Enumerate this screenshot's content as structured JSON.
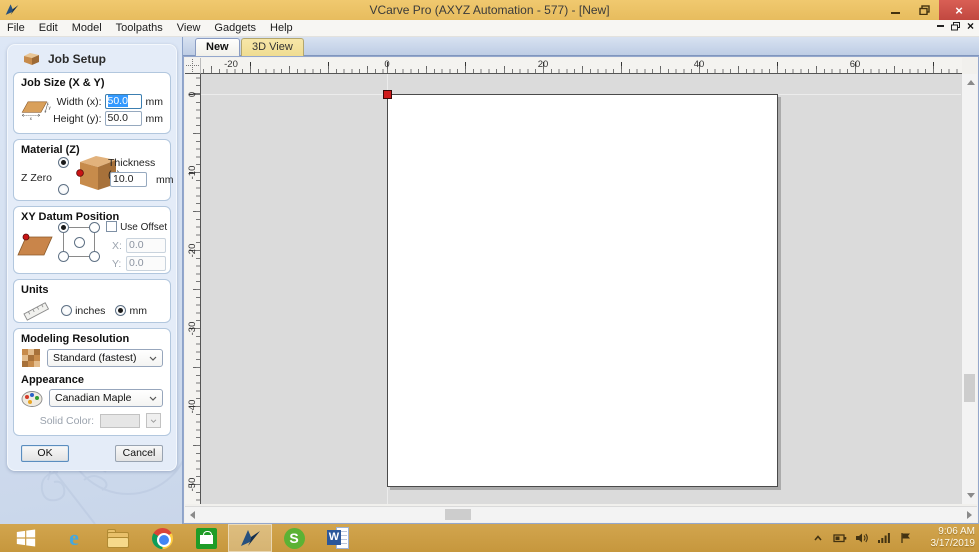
{
  "window": {
    "title": "VCarve Pro (AXYZ Automation - 577) - [New]"
  },
  "menu": {
    "items": [
      "File",
      "Edit",
      "Model",
      "Toolpaths",
      "View",
      "Gadgets",
      "Help"
    ]
  },
  "tabs": [
    {
      "label": "New",
      "active": true
    },
    {
      "label": "3D View",
      "active": false
    }
  ],
  "panel": {
    "title": "Job Setup",
    "job_size": {
      "title": "Job Size (X & Y)",
      "width_label": "Width (x):",
      "width_value": "50.0",
      "height_label": "Height (y):",
      "height_value": "50.0",
      "unit": "mm",
      "axis_x": "x",
      "axis_y": "y"
    },
    "material": {
      "title": "Material (Z)",
      "z_zero_label": "Z Zero",
      "thickness_label": "Thickness (z)",
      "thickness_value": "10.0",
      "unit": "mm"
    },
    "datum": {
      "title": "XY Datum Position",
      "use_offset_label": "Use Offset",
      "x_label": "X:",
      "x_value": "0.0",
      "y_label": "Y:",
      "y_value": "0.0"
    },
    "units": {
      "title": "Units",
      "inches_label": "inches",
      "mm_label": "mm",
      "selected": "mm"
    },
    "modeling": {
      "title": "Modeling Resolution",
      "value": "Standard (fastest)"
    },
    "appearance": {
      "title": "Appearance",
      "value": "Canadian Maple",
      "solid_color_label": "Solid Color:"
    },
    "ok_label": "OK",
    "cancel_label": "Cancel"
  },
  "rulers": {
    "h": [
      "-20",
      "0",
      "20",
      "40",
      "60"
    ],
    "v": [
      "0",
      "-10",
      "-20",
      "-30",
      "-40",
      "-50"
    ]
  },
  "taskbar": {
    "icons": [
      "start",
      "internet-explorer",
      "file-explorer",
      "chrome",
      "windows-store",
      "vcarve",
      "skype",
      "word"
    ],
    "time": "9:06 AM",
    "date": "3/17/2019"
  },
  "colors": {
    "titlebar_gold": "#E9BE63",
    "taskbar_gold": "#C8993F",
    "close_red": "#C75050",
    "selection_blue": "#3399FF",
    "origin_marker": "#CF1B1B",
    "panel_blue": "#D2DEEF",
    "canvas_gray": "#DBDBDB"
  }
}
